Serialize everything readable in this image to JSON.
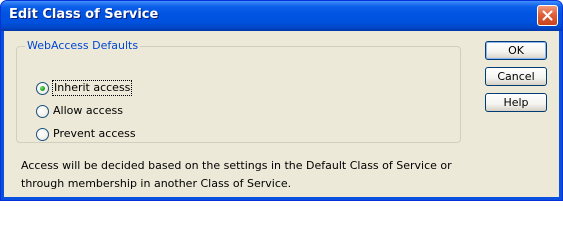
{
  "window": {
    "title": "Edit Class of Service",
    "close_icon": "close-icon"
  },
  "group": {
    "legend": "WebAccess Defaults",
    "options": [
      {
        "label": "Inherit access",
        "selected": true,
        "focused": true
      },
      {
        "label": "Allow access",
        "selected": false,
        "focused": false
      },
      {
        "label": "Prevent access",
        "selected": false,
        "focused": false
      }
    ]
  },
  "buttons": {
    "ok": "OK",
    "cancel": "Cancel",
    "help": "Help"
  },
  "info": {
    "line1": "Access will be decided based on the settings in the Default Class of Service or",
    "line2": "through membership in another Class of Service."
  },
  "colors": {
    "titlebar": "#0053e1",
    "dialog_bg": "#ece9d8",
    "legend_text": "#0046d5",
    "close_button": "#e0603a"
  }
}
